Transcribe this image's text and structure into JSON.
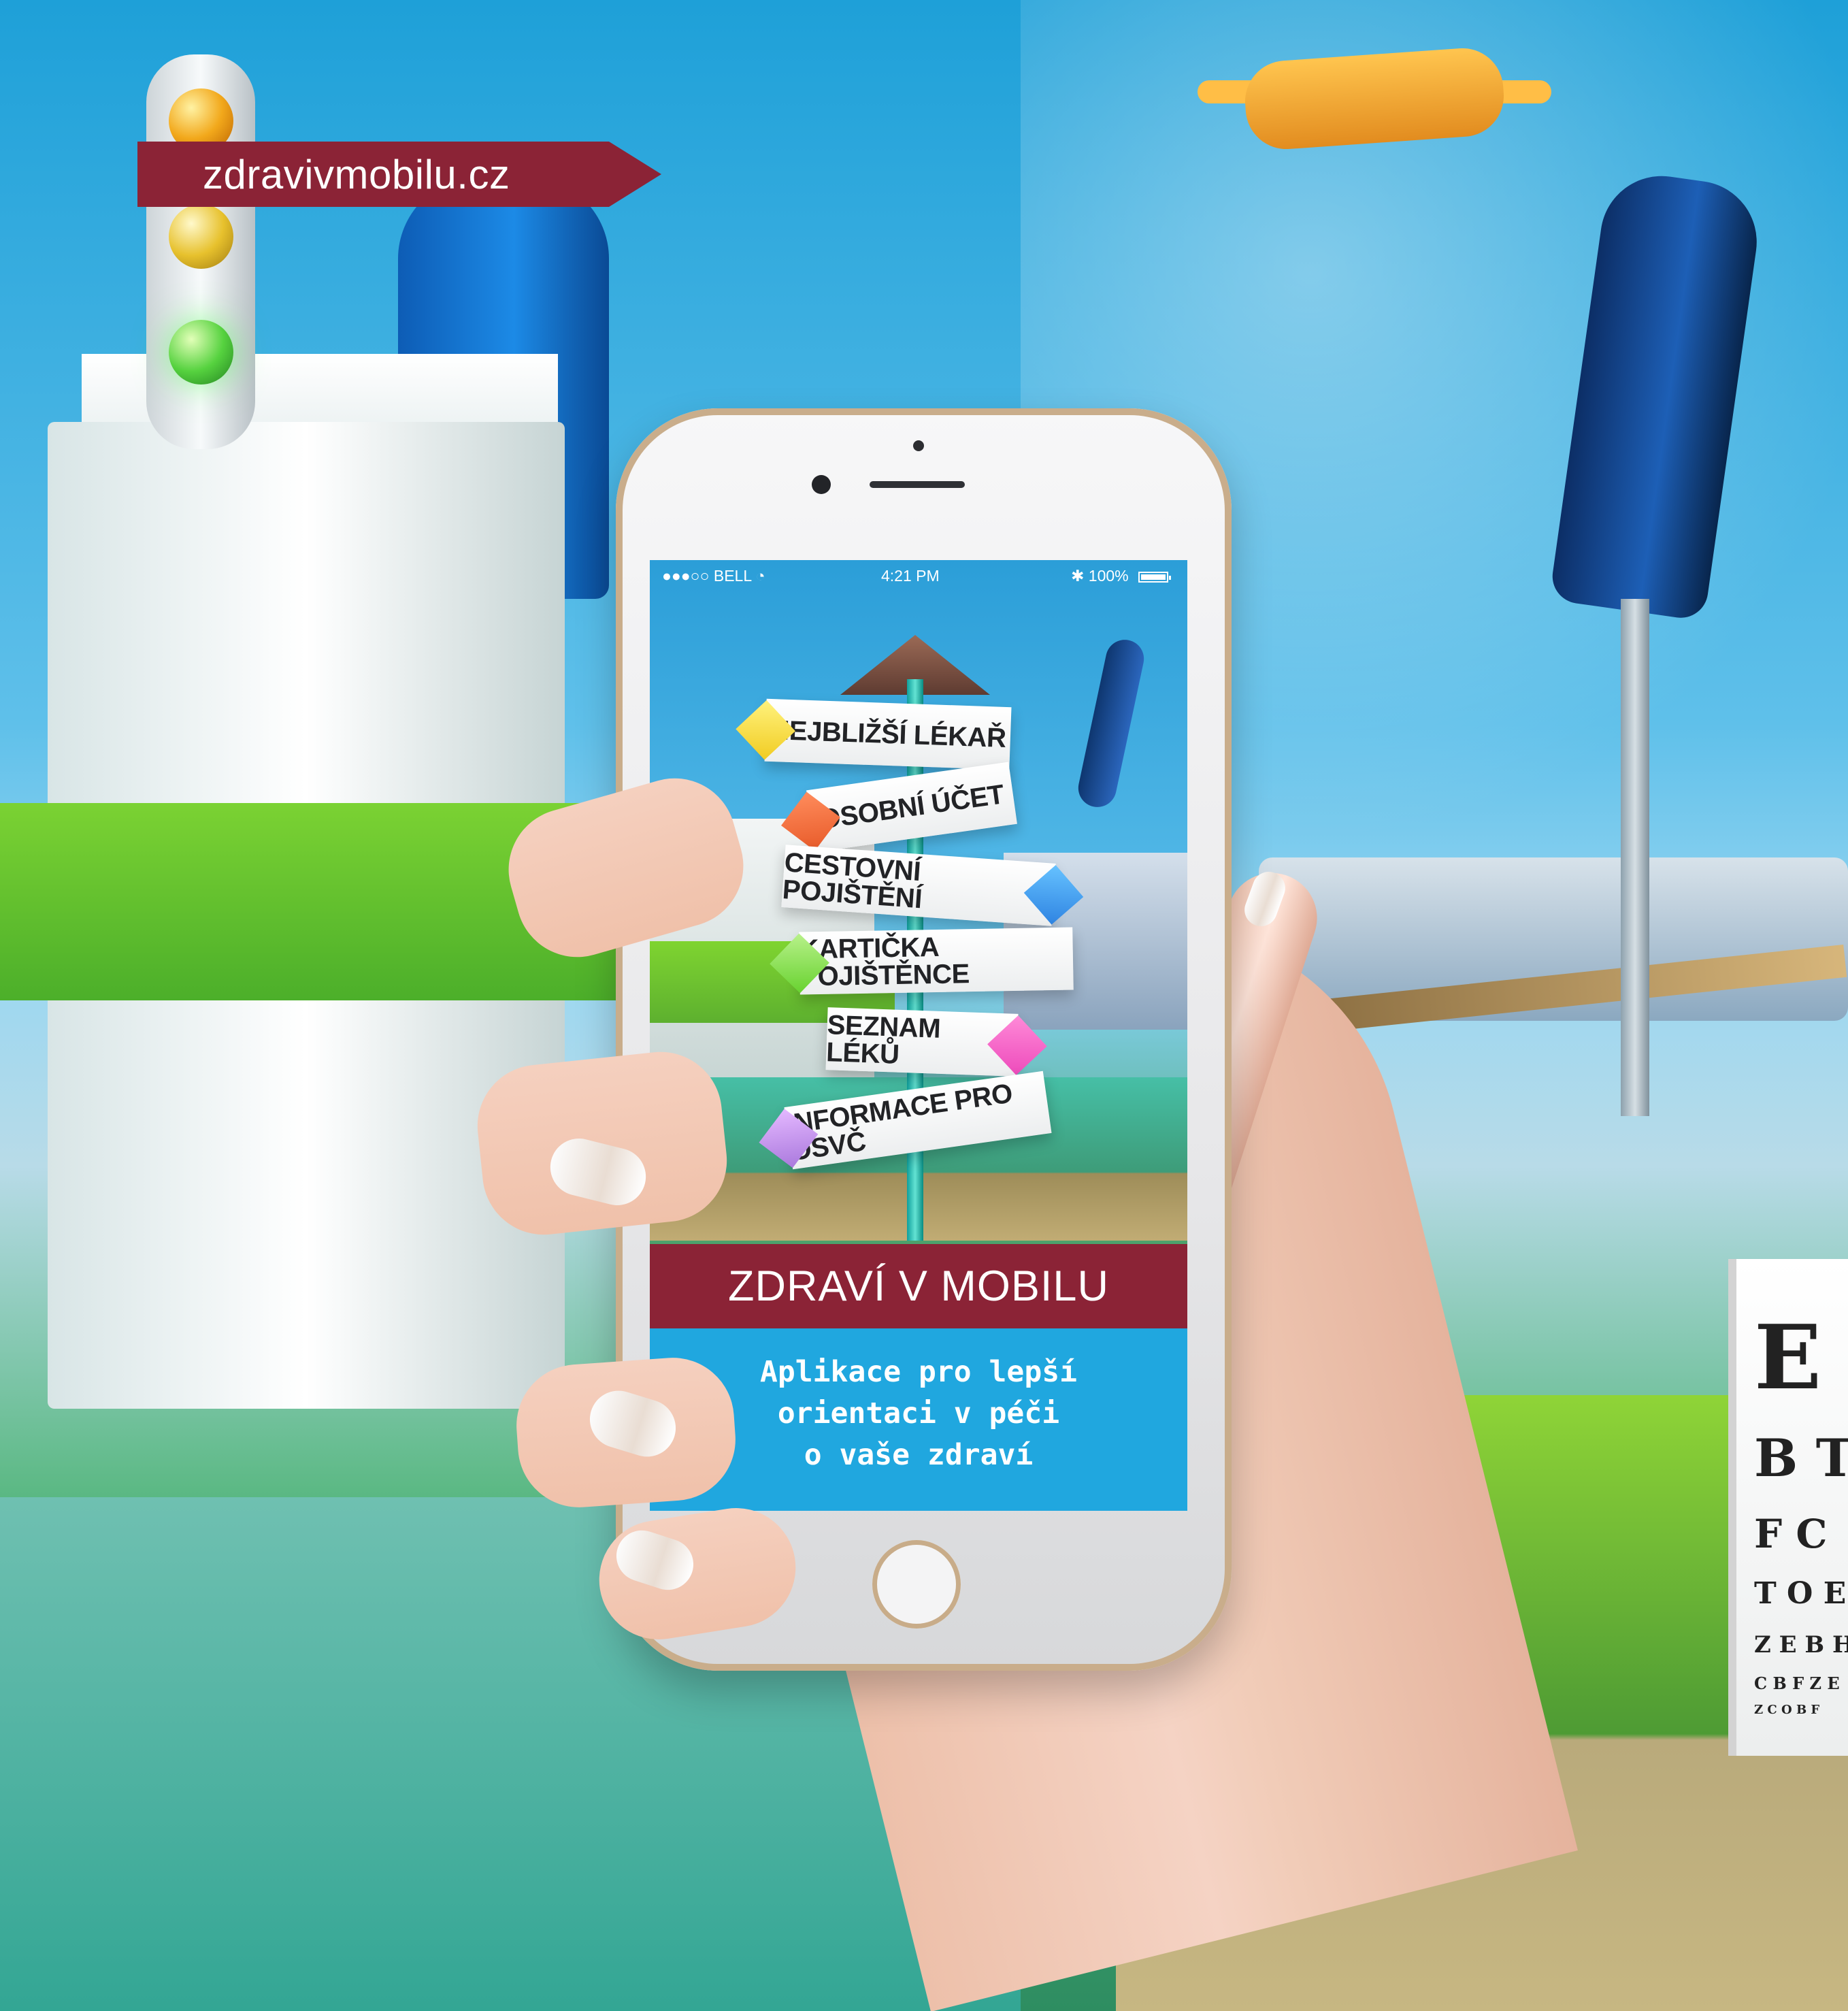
{
  "site": {
    "badge_text": "zdravivmobilu.cz"
  },
  "phone": {
    "status_bar": {
      "carrier": "BELL",
      "time": "4:21 PM",
      "battery": "100%"
    },
    "menu": [
      "NEJBLIŽŠÍ LÉKAŘ",
      "OSOBNÍ ÚČET",
      "CESTOVNÍ POJIŠTĚNÍ",
      "KARTIČKA POJIŠTĚNCE",
      "SEZNAM LÉKŮ",
      "INFORMACE PRO OSVČ"
    ],
    "title": "ZDRAVÍ V MOBILU",
    "subtitle_lines": [
      "Aplikace pro lepší",
      "orientaci v péči",
      "o vaše zdraví"
    ]
  },
  "scene": {
    "eye_chart_lines": [
      "E",
      "B T",
      "F C",
      "T O E",
      "Z E B H",
      "C B F Z E",
      "Z C O B F"
    ]
  }
}
